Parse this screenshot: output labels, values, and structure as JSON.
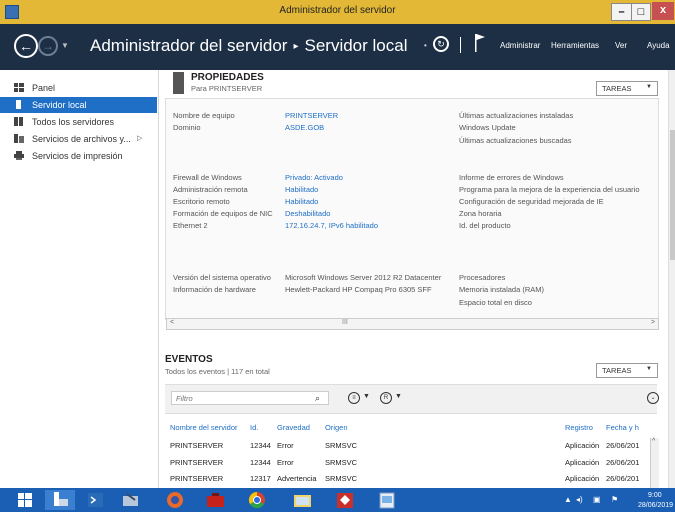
{
  "window": {
    "title": "Administrador del servidor",
    "min": "–",
    "max": "□",
    "close": "x"
  },
  "header": {
    "breadcrumb_root": "Administrador del servidor",
    "breadcrumb_sep": "▸",
    "breadcrumb_current": "Servidor local",
    "menu": [
      "Administrar",
      "Herramientas",
      "Ver",
      "Ayuda"
    ]
  },
  "sidebar": {
    "items": [
      {
        "label": "Panel",
        "icon": "dashboard-icon"
      },
      {
        "label": "Servidor local",
        "icon": "server-icon"
      },
      {
        "label": "Todos los servidores",
        "icon": "servers-icon"
      },
      {
        "label": "Servicios de archivos y...",
        "icon": "file-services-icon"
      },
      {
        "label": "Servicios de impresión",
        "icon": "printer-icon"
      }
    ]
  },
  "properties": {
    "title": "PROPIEDADES",
    "subtitle": "Para PRINTSERVER",
    "tasks_label": "TAREAS",
    "left_labels": {
      "computer_name": "Nombre de equipo",
      "domain": "Dominio",
      "firewall": "Firewall de Windows",
      "remote_admin": "Administración remota",
      "remote_desktop": "Escritorio remoto",
      "nic_teaming": "Formación de equipos de NIC",
      "ethernet": "Ethernet 2",
      "os_version": "Versión del sistema operativo",
      "hw_info": "Información de hardware"
    },
    "left_values": {
      "computer_name": "PRINTSERVER",
      "domain": "ASDE.GOB",
      "firewall": "Privado: Activado",
      "remote_admin": "Habilitado",
      "remote_desktop": "Habilitado",
      "nic_teaming": "Deshabilitado",
      "ethernet": "172.16.24.7, IPv6 habilitado",
      "os_version": "Microsoft Windows Server 2012 R2 Datacenter",
      "hw_info": "Hewlett-Packard HP Compaq Pro 6305 SFF"
    },
    "right_labels": {
      "updates_installed": "Últimas actualizaciones instaladas",
      "windows_update": "Windows Update",
      "updates_searched": "Últimas actualizaciones buscadas",
      "error_report": "Informe de errores de Windows",
      "ceip": "Programa para la mejora de la experiencia del usuario",
      "ie_esc": "Configuración de seguridad mejorada de IE",
      "timezone": "Zona horaria",
      "product_id": "Id. del producto",
      "processors": "Procesadores",
      "ram": "Memoria instalada (RAM)",
      "disk": "Espacio total en disco"
    }
  },
  "hscroll": {
    "left": "<",
    "middle": "III",
    "right": ">"
  },
  "events": {
    "title": "EVENTOS",
    "subtitle": "Todos los eventos | 117 en total",
    "tasks_label": "TAREAS",
    "filter_placeholder": "Filtro",
    "columns": [
      "Nombre del servidor",
      "Id.",
      "Gravedad",
      "Origen",
      "Registro",
      "Fecha y h"
    ],
    "rows": [
      [
        "PRINTSERVER",
        "12344",
        "Error",
        "SRMSVC",
        "Aplicación",
        "26/06/201"
      ],
      [
        "PRINTSERVER",
        "12344",
        "Error",
        "SRMSVC",
        "Aplicación",
        "26/06/201"
      ],
      [
        "PRINTSERVER",
        "12317",
        "Advertencia",
        "SRMSVC",
        "Aplicación",
        "26/06/201"
      ]
    ]
  },
  "taskbar": {
    "time": "9:00",
    "date": "28/06/2019",
    "colors": {
      "bar": "#1b5fb5",
      "title": "#e2b836",
      "header": "#1c2f45",
      "accent": "#1f6fc6"
    }
  }
}
